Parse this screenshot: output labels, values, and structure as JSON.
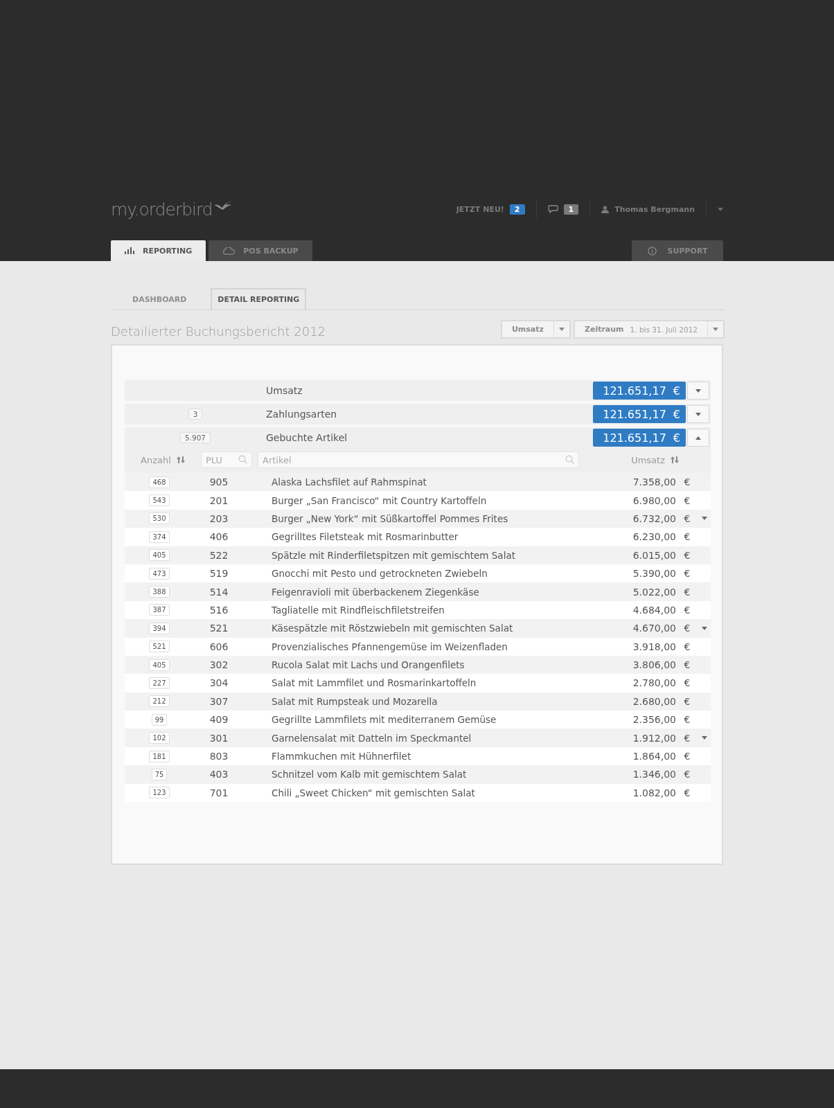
{
  "header": {
    "logo": "my.orderbird",
    "news": {
      "label": "JETZT NEU!",
      "count": "2"
    },
    "messages": {
      "count": "1"
    },
    "user": {
      "name": "Thomas Bergmann"
    }
  },
  "main_tabs": [
    {
      "label": "REPORTING",
      "selected": true
    },
    {
      "label": "POS BACKUP",
      "selected": false
    }
  ],
  "support": {
    "label": "SUPPORT"
  },
  "sub_tabs": [
    {
      "label": "DASHBOARD",
      "selected": false
    },
    {
      "label": "DETAIL REPORTING",
      "selected": true
    }
  ],
  "title": "Detailierter Buchungsbericht 2012",
  "filters": {
    "metric": "Umsatz",
    "period_label": "Zeitraum",
    "period_value": "1. bis 31. Juli 2012"
  },
  "summary": [
    {
      "label": "Umsatz",
      "amount": "121.651,17",
      "currency": "€",
      "expanded": false
    },
    {
      "count": "3",
      "label": "Zahlungsarten",
      "amount": "121.651,17",
      "currency": "€",
      "expanded": false
    },
    {
      "count": "5.907",
      "label": "Gebuchte Artikel",
      "amount": "121.651,17",
      "currency": "€",
      "expanded": true
    }
  ],
  "table": {
    "columns": {
      "count": "Anzahl",
      "plu_placeholder": "PLU",
      "article_placeholder": "Artikel",
      "revenue": "Umsatz"
    },
    "rows": [
      {
        "count": "468",
        "plu": "905",
        "article": "Alaska Lachsfilet auf Rahmspinat",
        "revenue": "7.358,00",
        "currency": "€",
        "menu": false
      },
      {
        "count": "543",
        "plu": "201",
        "article": "Burger „San Francisco“ mit Country Kartoffeln",
        "revenue": "6.980,00",
        "currency": "€",
        "menu": false
      },
      {
        "count": "530",
        "plu": "203",
        "article": "Burger „New York“ mit Süßkartoffel Pommes Frites",
        "revenue": "6.732,00",
        "currency": "€",
        "menu": true
      },
      {
        "count": "374",
        "plu": "406",
        "article": "Gegrilltes Filetsteak mit Rosmarinbutter",
        "revenue": "6.230,00",
        "currency": "€",
        "menu": false
      },
      {
        "count": "405",
        "plu": "522",
        "article": "Spätzle mit Rinderfiletspitzen mit gemischtem Salat",
        "revenue": "6.015,00",
        "currency": "€",
        "menu": false
      },
      {
        "count": "473",
        "plu": "519",
        "article": "Gnocchi mit Pesto und getrockneten Zwiebeln",
        "revenue": "5.390,00",
        "currency": "€",
        "menu": false
      },
      {
        "count": "388",
        "plu": "514",
        "article": "Feigenravioli mit überbackenem Ziegenkäse",
        "revenue": "5.022,00",
        "currency": "€",
        "menu": false
      },
      {
        "count": "387",
        "plu": "516",
        "article": "Tagliatelle mit Rindfleischfiletstreifen",
        "revenue": "4.684,00",
        "currency": "€",
        "menu": false
      },
      {
        "count": "394",
        "plu": "521",
        "article": "Käsespätzle mit Röstzwiebeln mit gemischten Salat",
        "revenue": "4.670,00",
        "currency": "€",
        "menu": true
      },
      {
        "count": "521",
        "plu": "606",
        "article": "Provenzialisches Pfannengemüse im Weizenfladen",
        "revenue": "3.918,00",
        "currency": "€",
        "menu": false
      },
      {
        "count": "405",
        "plu": "302",
        "article": "Rucola Salat mit Lachs und Orangenfilets",
        "revenue": "3.806,00",
        "currency": "€",
        "menu": false
      },
      {
        "count": "227",
        "plu": "304",
        "article": "Salat mit Lammfilet und Rosmarinkartoffeln",
        "revenue": "2.780,00",
        "currency": "€",
        "menu": false
      },
      {
        "count": "212",
        "plu": "307",
        "article": "Salat mit Rumpsteak und Mozarella",
        "revenue": "2.680,00",
        "currency": "€",
        "menu": false
      },
      {
        "count": "99",
        "plu": "409",
        "article": "Gegrillte Lammfilets mit mediterranem Gemüse",
        "revenue": "2.356,00",
        "currency": "€",
        "menu": false
      },
      {
        "count": "102",
        "plu": "301",
        "article": "Garnelensalat mit Datteln im Speckmantel",
        "revenue": "1.912,00",
        "currency": "€",
        "menu": true
      },
      {
        "count": "181",
        "plu": "803",
        "article": "Flammkuchen mit Hühnerfilet",
        "revenue": "1.864,00",
        "currency": "€",
        "menu": false
      },
      {
        "count": "75",
        "plu": "403",
        "article": "Schnitzel vom Kalb mit gemischtem Salat",
        "revenue": "1.346,00",
        "currency": "€",
        "menu": false
      },
      {
        "count": "123",
        "plu": "701",
        "article": "Chili „Sweet Chicken“ mit gemischten Salat",
        "revenue": "1.082,00",
        "currency": "€",
        "menu": false
      }
    ]
  }
}
